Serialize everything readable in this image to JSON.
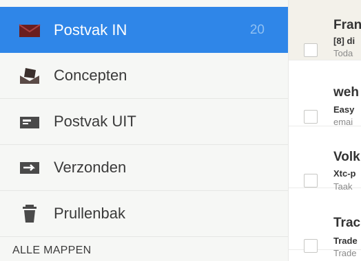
{
  "drawer": {
    "folders": [
      {
        "label": "Postvak IN",
        "count": "20",
        "icon": "inbox-icon",
        "active": true
      },
      {
        "label": "Concepten",
        "count": "",
        "icon": "drafts-icon",
        "active": false
      },
      {
        "label": "Postvak UIT",
        "count": "",
        "icon": "outbox-icon",
        "active": false
      },
      {
        "label": "Verzonden",
        "count": "",
        "icon": "sent-icon",
        "active": false
      },
      {
        "label": "Prullenbak",
        "count": "",
        "icon": "trash-icon",
        "active": false
      }
    ],
    "section_header": "ALLE MAPPEN"
  },
  "messages": [
    {
      "from": "Fran",
      "subject": "[8] di",
      "snippet": "Toda"
    },
    {
      "from": "weh",
      "subject": "Easy",
      "snippet": "emai"
    },
    {
      "from": "Volk",
      "subject": "Xtc-p",
      "snippet": "Taak"
    },
    {
      "from": "Trac",
      "subject": "Trade",
      "snippet": "Trade"
    }
  ],
  "colors": {
    "active_row": "#2f86e8",
    "drawer_bg": "#f6f7f5",
    "inbox_icon": "#7a2424"
  }
}
